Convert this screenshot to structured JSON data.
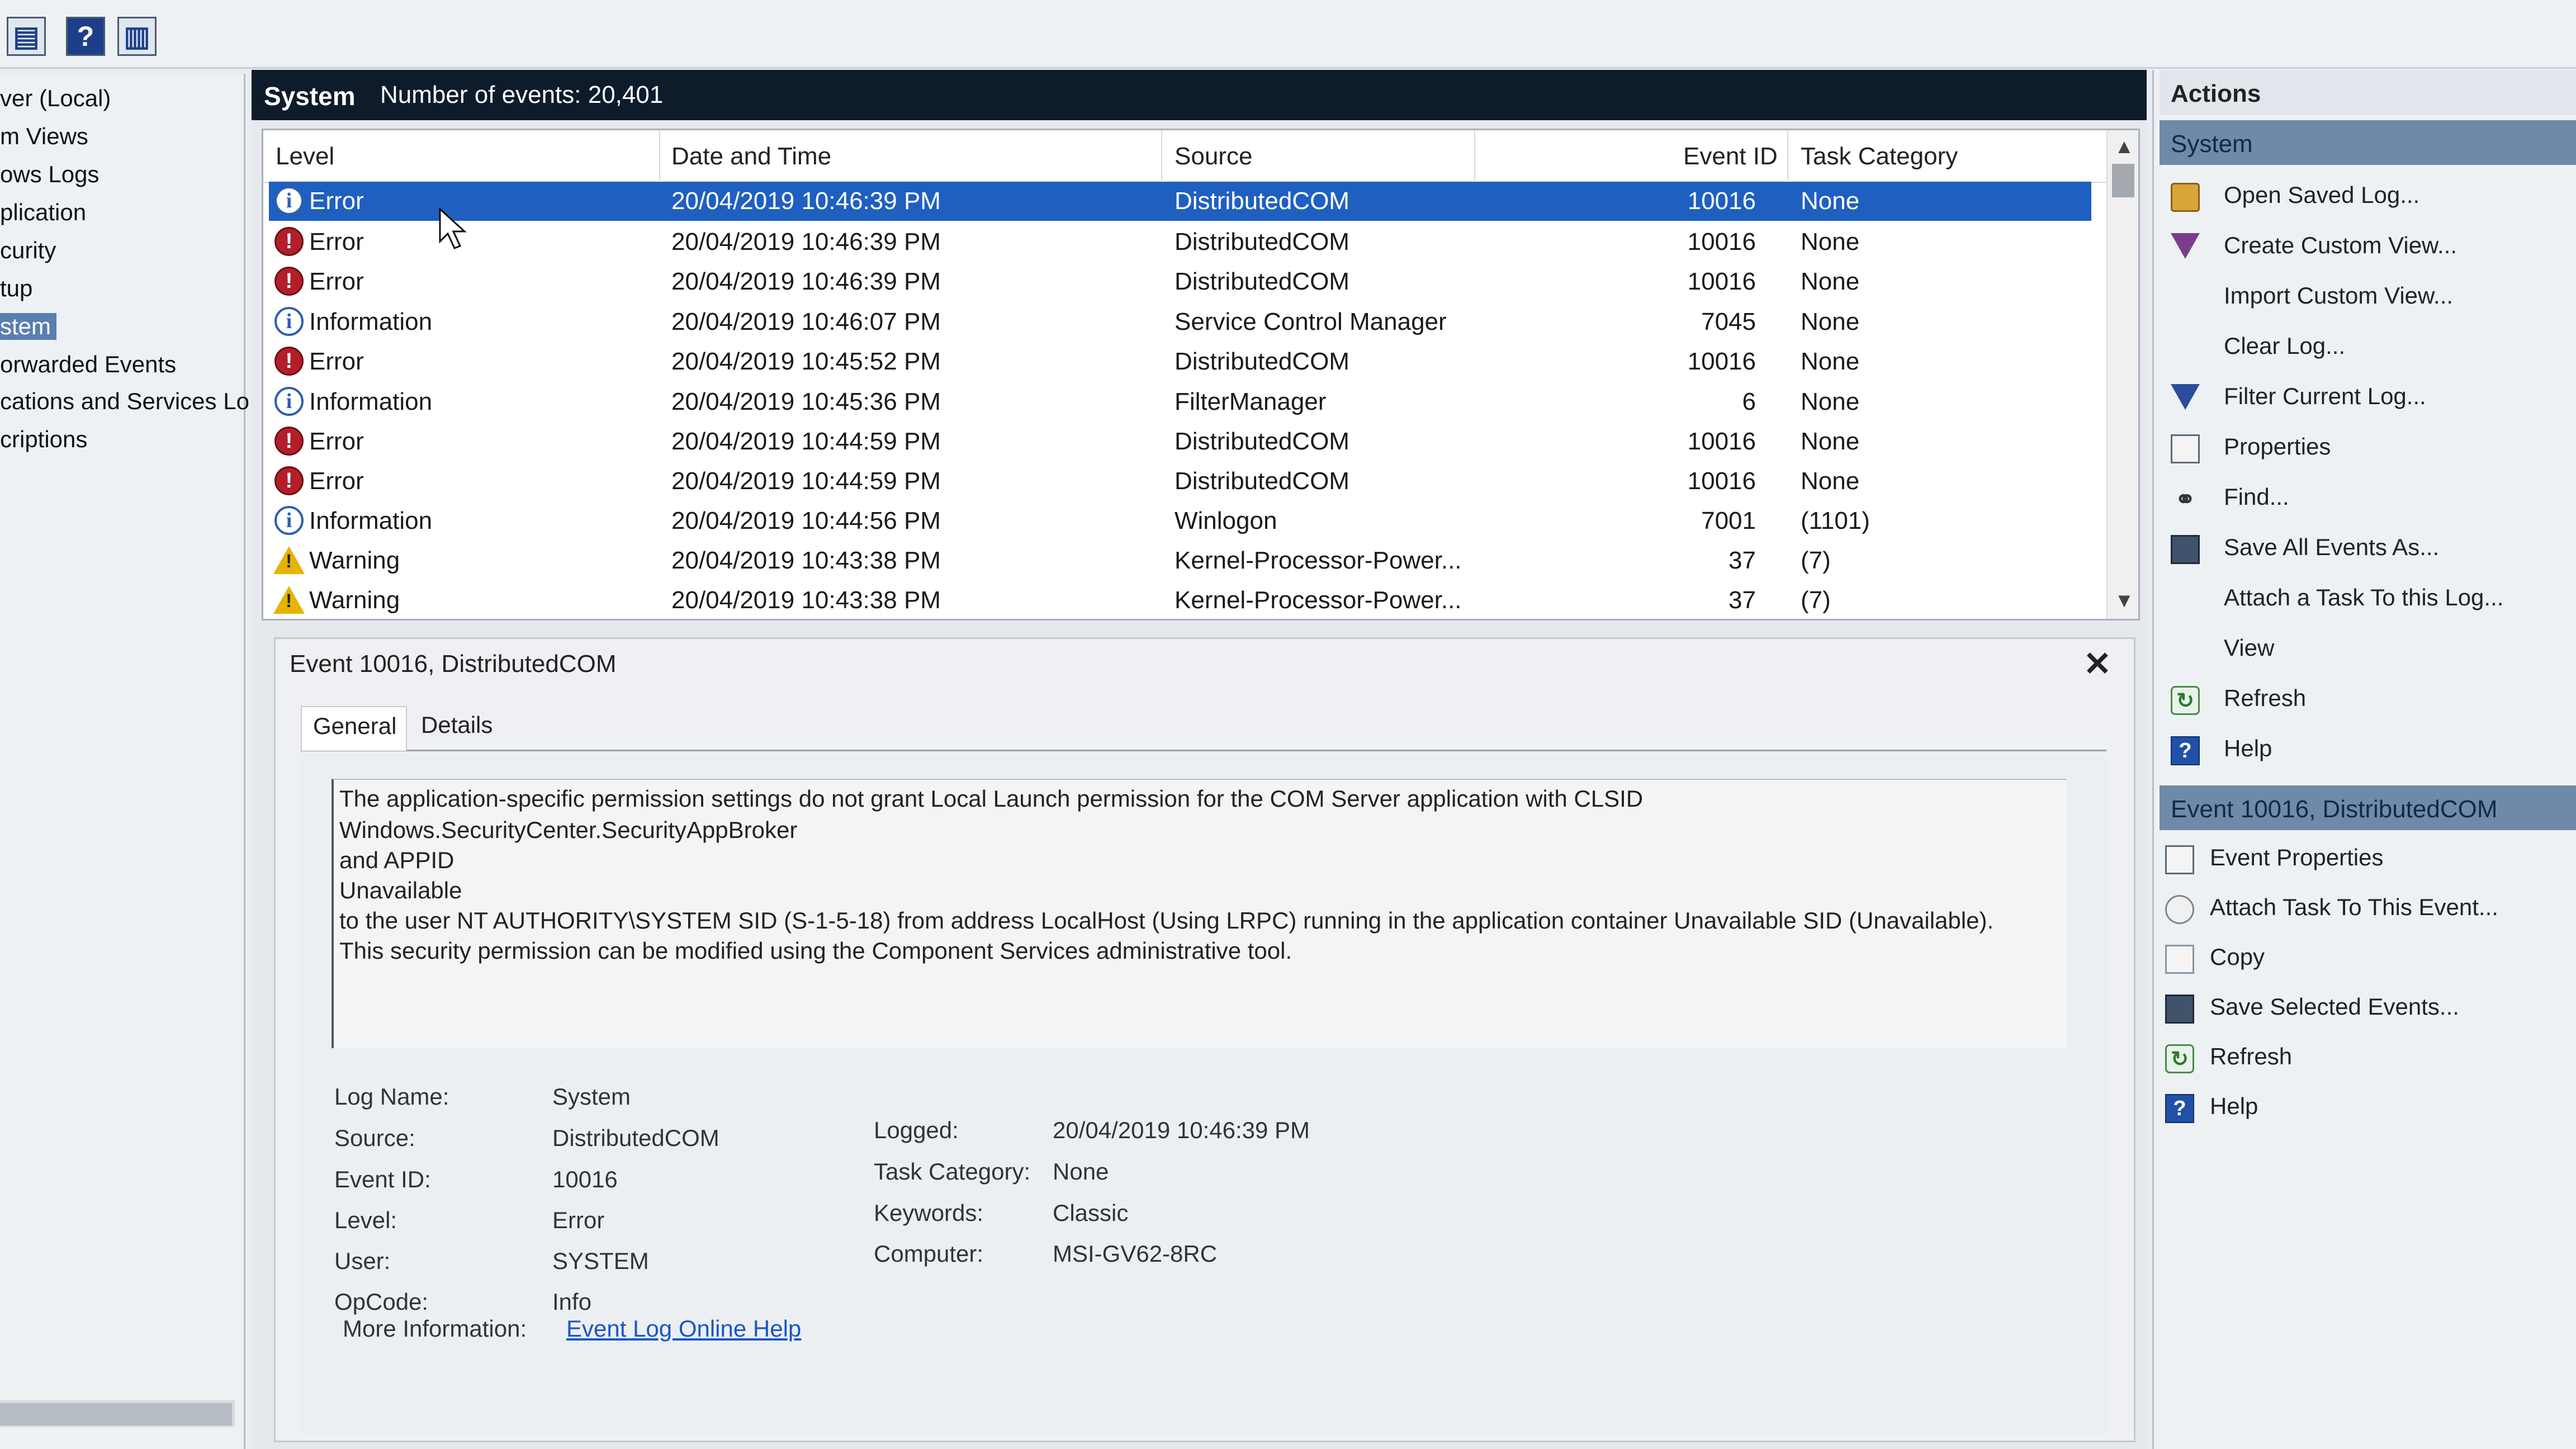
{
  "toolbar": {
    "icons": [
      "console-tree-icon",
      "help-icon",
      "show-action-pane-icon"
    ],
    "help_glyph": "?"
  },
  "tree": {
    "items": [
      {
        "label": "ver (Local)",
        "selected": false
      },
      {
        "label": "m Views",
        "selected": false
      },
      {
        "label": "ows Logs",
        "selected": false
      },
      {
        "label": "plication",
        "selected": false
      },
      {
        "label": "curity",
        "selected": false
      },
      {
        "label": "tup",
        "selected": false
      },
      {
        "label": "stem",
        "selected": true
      },
      {
        "label": "orwarded Events",
        "selected": false
      },
      {
        "label": "cations and Services Lo",
        "selected": false
      },
      {
        "label": "criptions",
        "selected": false
      }
    ],
    "scroll_arrow": "›"
  },
  "center": {
    "log_name": "System",
    "event_count": "Number of events: 20,401"
  },
  "grid": {
    "columns": [
      "Level",
      "Date and Time",
      "Source",
      "Event ID",
      "Task Category"
    ],
    "rows": [
      {
        "level": "Error",
        "kind": "info",
        "datetime": "20/04/2019 10:46:39 PM",
        "source": "DistributedCOM",
        "event_id": "10016",
        "task": "None",
        "selected": true
      },
      {
        "level": "Error",
        "kind": "error",
        "datetime": "20/04/2019 10:46:39 PM",
        "source": "DistributedCOM",
        "event_id": "10016",
        "task": "None",
        "selected": false
      },
      {
        "level": "Error",
        "kind": "error",
        "datetime": "20/04/2019 10:46:39 PM",
        "source": "DistributedCOM",
        "event_id": "10016",
        "task": "None",
        "selected": false
      },
      {
        "level": "Information",
        "kind": "info",
        "datetime": "20/04/2019 10:46:07 PM",
        "source": "Service Control Manager",
        "event_id": "7045",
        "task": "None",
        "selected": false
      },
      {
        "level": "Error",
        "kind": "error",
        "datetime": "20/04/2019 10:45:52 PM",
        "source": "DistributedCOM",
        "event_id": "10016",
        "task": "None",
        "selected": false
      },
      {
        "level": "Information",
        "kind": "info",
        "datetime": "20/04/2019 10:45:36 PM",
        "source": "FilterManager",
        "event_id": "6",
        "task": "None",
        "selected": false
      },
      {
        "level": "Error",
        "kind": "error",
        "datetime": "20/04/2019 10:44:59 PM",
        "source": "DistributedCOM",
        "event_id": "10016",
        "task": "None",
        "selected": false
      },
      {
        "level": "Error",
        "kind": "error",
        "datetime": "20/04/2019 10:44:59 PM",
        "source": "DistributedCOM",
        "event_id": "10016",
        "task": "None",
        "selected": false
      },
      {
        "level": "Information",
        "kind": "info",
        "datetime": "20/04/2019 10:44:56 PM",
        "source": "Winlogon",
        "event_id": "7001",
        "task": "(1101)",
        "selected": false
      },
      {
        "level": "Warning",
        "kind": "warning",
        "datetime": "20/04/2019 10:43:38 PM",
        "source": "Kernel-Processor-Power...",
        "event_id": "37",
        "task": "(7)",
        "selected": false
      },
      {
        "level": "Warning",
        "kind": "warning",
        "datetime": "20/04/2019 10:43:38 PM",
        "source": "Kernel-Processor-Power...",
        "event_id": "37",
        "task": "(7)",
        "selected": false
      }
    ]
  },
  "detail": {
    "title": "Event 10016, DistributedCOM",
    "close": "✕",
    "tabs": [
      "General",
      "Details"
    ],
    "description": [
      "The application-specific permission settings do not grant Local Launch permission for the COM Server application with CLSID",
      "Windows.SecurityCenter.SecurityAppBroker",
      " and APPID",
      "Unavailable",
      " to the user NT AUTHORITY\\SYSTEM SID (S-1-5-18) from address LocalHost (Using LRPC) running in the application container Unavailable SID (Unavailable).",
      "This security permission can be modified using the Component Services administrative tool."
    ],
    "props_left": [
      {
        "label": "Log Name:",
        "value": "System"
      },
      {
        "label": "Source:",
        "value": "DistributedCOM"
      },
      {
        "label": "Event ID:",
        "value": "10016"
      },
      {
        "label": "Level:",
        "value": "Error"
      },
      {
        "label": "User:",
        "value": "SYSTEM"
      },
      {
        "label": "OpCode:",
        "value": "Info"
      }
    ],
    "props_right": [
      {
        "label": "Logged:",
        "value": "20/04/2019 10:46:39 PM"
      },
      {
        "label": "Task Category:",
        "value": "None"
      },
      {
        "label": "Keywords:",
        "value": "Classic"
      },
      {
        "label": "Computer:",
        "value": "MSI-GV62-8RC"
      }
    ],
    "more_info_label": "More Information:",
    "more_info_link": "Event Log Online Help"
  },
  "actions": {
    "header": "Actions",
    "section1": "System",
    "items1": [
      {
        "label": "Open Saved Log...",
        "icon": "folder-icon"
      },
      {
        "label": "Create Custom View...",
        "icon": "funnel-icon"
      },
      {
        "label": "Import Custom View...",
        "icon": ""
      },
      {
        "label": "Clear Log...",
        "icon": ""
      },
      {
        "label": "Filter Current Log...",
        "icon": "filter-icon"
      },
      {
        "label": "Properties",
        "icon": "properties-icon"
      },
      {
        "label": "Find...",
        "icon": "binoculars-icon"
      },
      {
        "label": "Save All Events As...",
        "icon": "disk-icon"
      },
      {
        "label": "Attach a Task To this Log...",
        "icon": ""
      },
      {
        "label": "View",
        "icon": ""
      },
      {
        "label": "Refresh",
        "icon": "refresh-icon"
      },
      {
        "label": "Help",
        "icon": "help-icon"
      }
    ],
    "section2": "Event 10016, DistributedCOM",
    "items2": [
      {
        "label": "Event Properties",
        "icon": "properties-icon"
      },
      {
        "label": "Attach Task To This Event...",
        "icon": "task-icon"
      },
      {
        "label": "Copy",
        "icon": "copy-icon"
      },
      {
        "label": "Save Selected Events...",
        "icon": "disk-icon"
      },
      {
        "label": "Refresh",
        "icon": "refresh-icon"
      },
      {
        "label": "Help",
        "icon": "help-icon"
      }
    ],
    "help_glyph": "?"
  },
  "colors": {
    "selection": "#1f5fbf",
    "header_bg": "#0e1b2b",
    "actions_section": "#6f89a8",
    "error": "#b21f2a",
    "info": "#2b5fae",
    "warning": "#e6b400",
    "link": "#1a56c8"
  }
}
